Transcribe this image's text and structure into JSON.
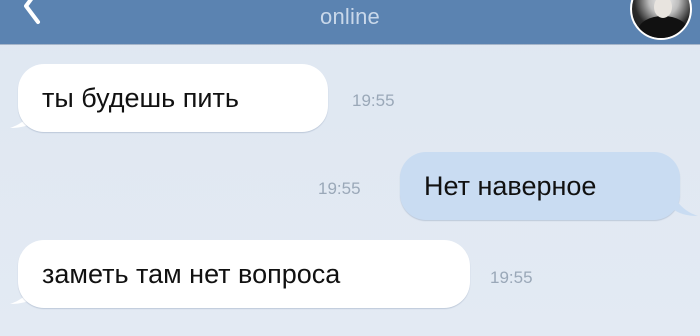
{
  "header": {
    "status": "online",
    "back_icon": "chevron-left-icon",
    "colors": {
      "bar": "#5b83b1",
      "status_text": "#c9d8ea"
    }
  },
  "messages": [
    {
      "direction": "incoming",
      "text": "ты будешь пить",
      "time": "19:55"
    },
    {
      "direction": "outgoing",
      "text": "Нет наверное",
      "time": "19:55"
    },
    {
      "direction": "incoming",
      "text": "заметь там нет вопроса",
      "time": "19:55"
    }
  ],
  "colors": {
    "background": "#e0e8f2",
    "incoming_bubble": "#ffffff",
    "outgoing_bubble": "#c9dcf2",
    "timestamp": "#9aa8b8"
  }
}
